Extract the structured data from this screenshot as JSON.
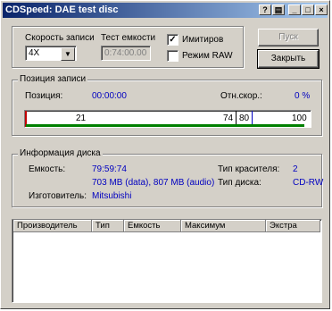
{
  "window": {
    "title": "CDSpeed: DAE test disc"
  },
  "write_speed": {
    "label": "Скорость записи",
    "value": "4X"
  },
  "test_capacity": {
    "label": "Тест емкости",
    "value": "0:74:00.00"
  },
  "options": {
    "simulate_label": "Имитиров",
    "simulate_checked": true,
    "raw_mode_label": "Режим RAW",
    "raw_mode_checked": false
  },
  "buttons": {
    "start_label": "Пуск",
    "close_label": "Закрыть"
  },
  "write_position": {
    "title": "Позиция записи",
    "position_label": "Позиция:",
    "position_value": "00:00:00",
    "ratio_label": "Отн.скор.:",
    "ratio_value": "0 %",
    "progress_fraction": 0.98,
    "scale_start": "21",
    "scale_mid1": "74",
    "scale_mid2": "80",
    "scale_end": "100"
  },
  "disc_info": {
    "title": "Информация диска",
    "capacity_label": "Емкость:",
    "capacity_value": "79:59:74",
    "capacity_detail": "703 MB (data), 807 MB (audio)",
    "manufacturer_label": "Изготовитель:",
    "manufacturer_value": "Mitsubishi",
    "dye_label": "Тип красителя:",
    "dye_value": "2",
    "disc_type_label": "Тип диска:",
    "disc_type_value": "CD-RW"
  },
  "table": {
    "columns": [
      "Производитель",
      "Тип",
      "Емкость",
      "Максимум",
      "Экстра"
    ]
  },
  "colors": {
    "progress_green": "#008000",
    "value_blue": "#0000c0",
    "title_dark": "#0a246a",
    "title_light": "#a6caf0"
  }
}
